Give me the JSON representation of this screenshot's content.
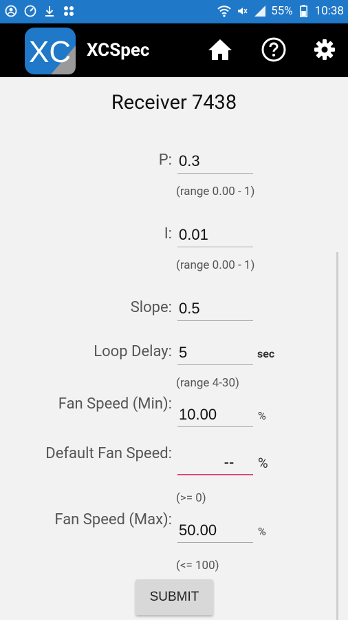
{
  "status_bar": {
    "left_icons": [
      "account-circle-icon",
      "speedometer-icon",
      "download-icon",
      "apps-grid-icon"
    ],
    "battery": "55%",
    "time": "10:38"
  },
  "app_bar": {
    "title": "XCSpec",
    "logo_text": "XC"
  },
  "page": {
    "title": "Receiver 7438"
  },
  "fields": {
    "p": {
      "label": "P:",
      "value": "0.3",
      "hint": "(range 0.00 - 1)"
    },
    "i": {
      "label": "I:",
      "value": "0.01",
      "hint": "(range 0.00 - 1)"
    },
    "slope": {
      "label": "Slope:",
      "value": "0.5"
    },
    "loop_delay": {
      "label": "Loop Delay:",
      "value": "5",
      "unit": "sec",
      "hint": "(range 4-30)"
    },
    "fan_min": {
      "label": "Fan Speed (Min):",
      "value": "10.00",
      "unit": "%"
    },
    "fan_default": {
      "label": "Default Fan Speed:",
      "value": "--",
      "unit": "%",
      "hint": "(>= 0)"
    },
    "fan_max": {
      "label": "Fan Speed (Max):",
      "value": "50.00",
      "unit": "%",
      "hint": "(<= 100)"
    }
  },
  "submit_label": "SUBMIT",
  "colors": {
    "status_bar": "#1f78c8",
    "app_bar": "#000000",
    "focus_underline": "#e0457b"
  }
}
